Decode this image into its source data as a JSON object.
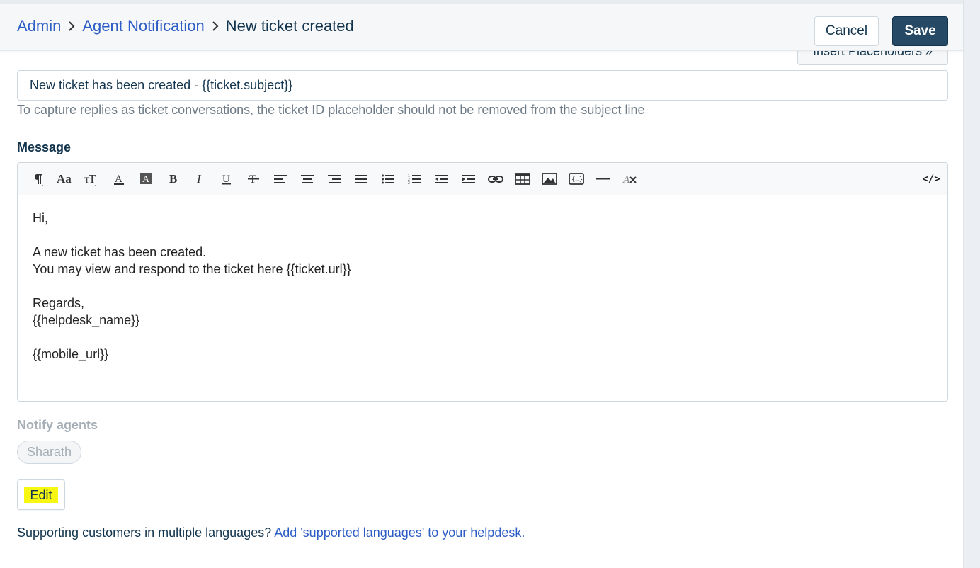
{
  "breadcrumb": {
    "items": [
      {
        "label": "Admin"
      },
      {
        "label": "Agent Notification"
      },
      {
        "label": "New ticket created"
      }
    ]
  },
  "header": {
    "cancel_label": "Cancel",
    "save_label": "Save"
  },
  "subject": {
    "insert_placeholders_label": "Insert Placeholders »",
    "value": "New ticket has been created - {{ticket.subject}}",
    "hint": "To capture replies as ticket conversations, the ticket ID placeholder should not be removed from the subject line"
  },
  "message": {
    "label": "Message",
    "toolbar": {
      "code_view_label": "</>"
    },
    "body": {
      "line1": "Hi,",
      "line2": "A new ticket has been created.",
      "line3": "You may view and respond to the ticket here {{ticket.url}}",
      "line4": "Regards,",
      "line5": "{{helpdesk_name}}",
      "line6": "{{mobile_url}}"
    }
  },
  "notify": {
    "label": "Notify agents",
    "agents": [
      "Sharath"
    ],
    "edit_label": "Edit"
  },
  "footer": {
    "text": "Supporting customers in multiple languages? ",
    "link_label": "Add 'supported languages' to your helpdesk."
  },
  "colors": {
    "link": "#2c5cc5",
    "primary_button": "#264966",
    "highlight": "#f7f711",
    "muted_text": "#a7afb6"
  }
}
